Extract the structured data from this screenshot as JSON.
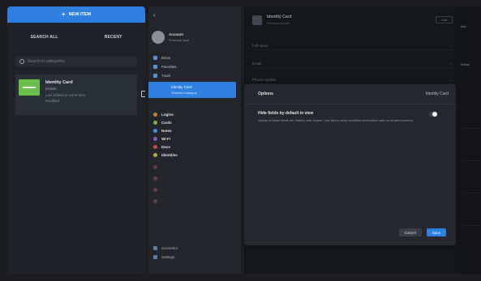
{
  "left": {
    "add_button": "NEW ITEM",
    "tabs": [
      "SEARCH ALL",
      "RECENT"
    ],
    "search_placeholder": "Search in categories",
    "item": {
      "title": "Identity Card",
      "line1": "Details",
      "line2": "Last edited at some time",
      "line3": "Modified"
    }
  },
  "sidebar": {
    "account_name": "Account",
    "account_sub": "Personal vault",
    "nav": [
      "Items",
      "Favorites",
      "Trash"
    ],
    "active": {
      "label": "Identity Card",
      "sub": "Selected category"
    },
    "categories": [
      "Logins",
      "Cards",
      "Notes",
      "Wi-Fi",
      "Docs",
      "Identities"
    ],
    "bottom": [
      "Generator",
      "Settings"
    ]
  },
  "detail": {
    "title": "Identity Card",
    "subtitle": "Personal details",
    "edit_label": "Edit",
    "rows": [
      {
        "label": "Full name",
        "value": "—"
      },
      {
        "label": "Email",
        "value": "—"
      },
      {
        "label": "Phone number",
        "value": "—"
      }
    ]
  },
  "right_strip": {
    "label1": "Info",
    "label2": "Fields"
  },
  "modal": {
    "title": "Options",
    "right_label": "Identity Card",
    "setting_title": "Hide fields by default in view",
    "setting_desc": "Values of these fields are hidden until clicked. Use this to keep sensitive information safe on shared screens.",
    "toggle_on": true,
    "cancel_label": "Cancel",
    "save_label": "Save"
  },
  "colors": {
    "accent": "#2f7fe0",
    "item_thumb": "#69c04a"
  }
}
